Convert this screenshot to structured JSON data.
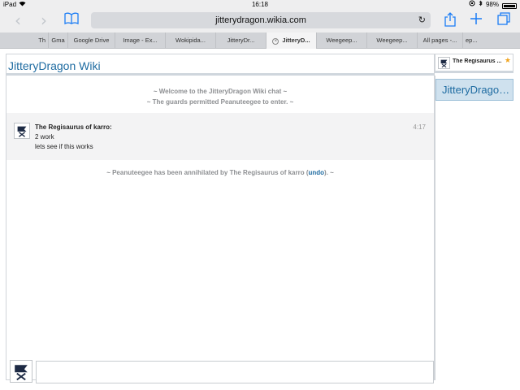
{
  "status_bar": {
    "device": "iPad",
    "time": "16:18",
    "battery": "98%",
    "battery_level": 0.98
  },
  "toolbar": {
    "url": "jitterydragon.wikia.com",
    "icons": [
      "back-icon",
      "forward-icon",
      "bookmarks-icon",
      "reload-icon",
      "share-icon",
      "new-tab-icon",
      "tabs-icon"
    ]
  },
  "tabs": [
    {
      "label": "Th"
    },
    {
      "label": "Gma"
    },
    {
      "label": "Google Drive"
    },
    {
      "label": "Image - Ex..."
    },
    {
      "label": "Wokipida..."
    },
    {
      "label": "JitteryDr..."
    },
    {
      "label": "JitteryD...",
      "active": true
    },
    {
      "label": "Weegeep..."
    },
    {
      "label": "Weegeep..."
    },
    {
      "label": "All pages -..."
    },
    {
      "label": "ep..."
    }
  ],
  "chat": {
    "wiki_title": "JitteryDragon Wiki",
    "alerts": [
      "~ Welcome to the JitteryDragon Wiki chat ~",
      "~ The guards permitted Peanuteegee to enter. ~"
    ],
    "message": {
      "user": "The Regisaurus of karro:",
      "time": "4:17",
      "lines": [
        "2 work",
        "lets see if this works"
      ]
    },
    "kick_alert": {
      "before": "~ Peanuteegee has been annihilated by The Regisaurus of karro (",
      "undo": "undo",
      "after": "). ~"
    },
    "input_value": ""
  },
  "sidebar": {
    "user_name": "The Regisaurus ...",
    "room": "JitteryDragon Wiki"
  },
  "colors": {
    "link": "#1e6ba1",
    "room_highlight": "#cfe1ee",
    "ios_blue": "#1a7cf5",
    "star": "#f0a41e"
  }
}
